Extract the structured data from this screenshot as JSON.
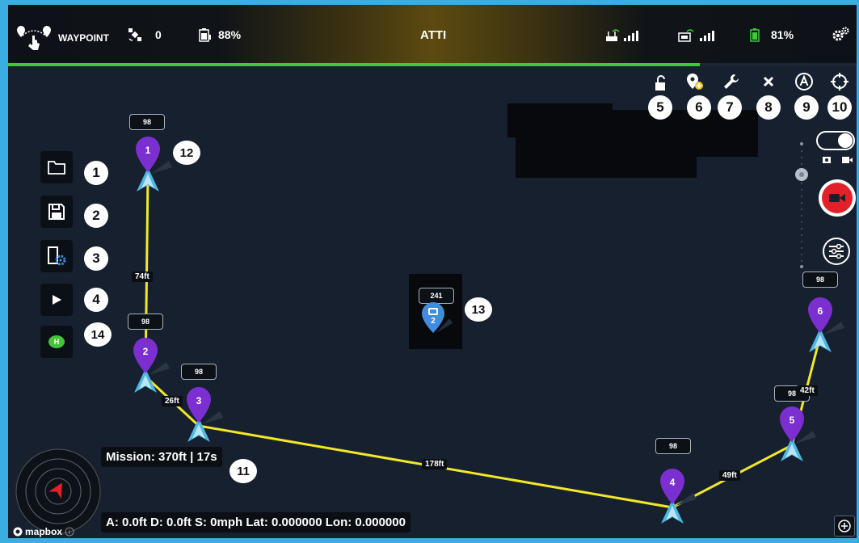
{
  "topbar": {
    "mode": "WAYPOINT",
    "satellites": "0",
    "remote_battery": "88%",
    "flight_mode": "ATTI",
    "aircraft_battery": "81%"
  },
  "progress": 0.815,
  "sidebar": {
    "callouts": [
      "1",
      "2",
      "3",
      "4",
      "14"
    ]
  },
  "toolbar": {
    "callouts": [
      "5",
      "6",
      "7",
      "8",
      "9",
      "10"
    ]
  },
  "waypoints": [
    {
      "label": "1",
      "altitude": "98"
    },
    {
      "label": "2",
      "altitude": "98"
    },
    {
      "label": "3",
      "altitude": "98"
    },
    {
      "label": "4",
      "altitude": "98"
    },
    {
      "label": "5",
      "altitude": "98"
    },
    {
      "label": "6",
      "altitude": "98"
    }
  ],
  "poi": {
    "label": "2",
    "altitude": "241"
  },
  "segments": [
    "74ft",
    "26ft",
    "178ft",
    "49ft",
    "42ft"
  ],
  "callouts_map": {
    "waypoint": "12",
    "poi": "13",
    "mission": "11"
  },
  "mission_summary": "Mission: 370ft | 17s",
  "telemetry": "A: 0.0ft D: 0.0ft S: 0mph Lat: 0.000000 Lon: 0.000000",
  "mapbox": "mapbox",
  "colors": {
    "waypoint": "#7b2fd0",
    "route": "#f2e829",
    "record": "#e3202a",
    "progress": "#3fca3a",
    "poi": "#3f8ce0"
  }
}
